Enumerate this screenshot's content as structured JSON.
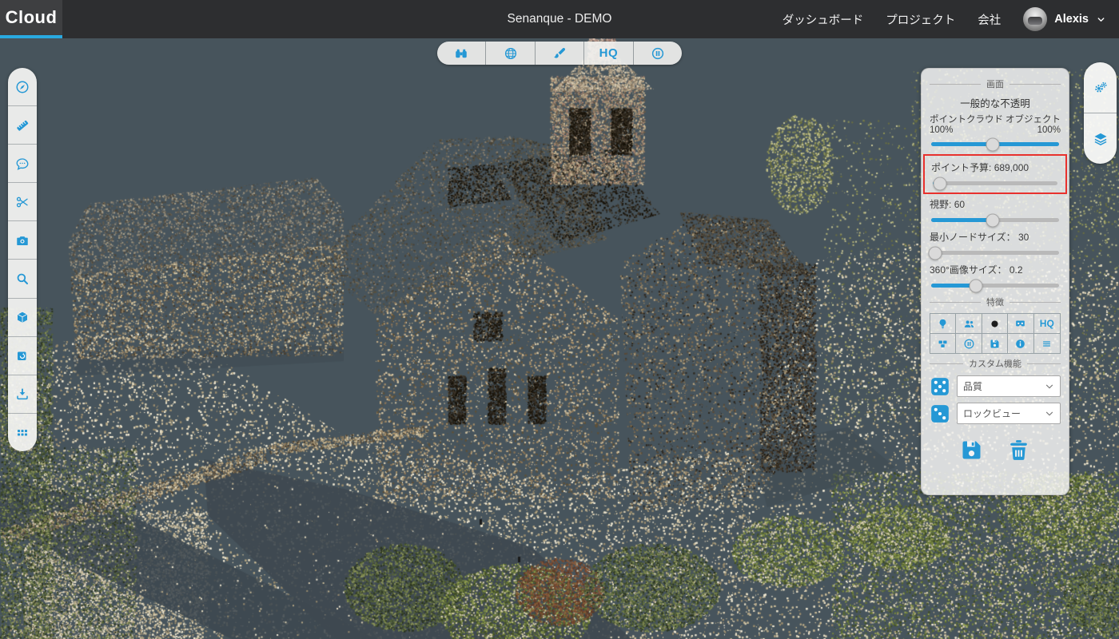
{
  "navbar": {
    "brand": "Cloud",
    "title": "Senanque - DEMO",
    "menu": [
      {
        "label": "ダッシュボード"
      },
      {
        "label": "プロジェクト"
      },
      {
        "label": "会社"
      }
    ],
    "user": {
      "name": "Alexis"
    }
  },
  "viewer_toolbar": {
    "hq_label": "HQ",
    "icons": [
      "binoculars",
      "globe",
      "brush",
      "hq",
      "pause-circle"
    ]
  },
  "left_toolbar": {
    "icons": [
      "compass",
      "ruler",
      "comment",
      "scissors",
      "camera",
      "search",
      "cube",
      "rotate-view",
      "download",
      "apps-grid"
    ]
  },
  "side_buttons": {
    "icons": [
      "gears",
      "layers"
    ]
  },
  "right_panel": {
    "screen": {
      "title": "画面",
      "opacity_heading": "一般的な不透明",
      "pointcloud_label": "ポイントクラウド",
      "object_label": "オブジェクト",
      "pointcloud_value": "100%",
      "object_value": "100%",
      "point_budget_label": "ポイント予算:",
      "point_budget_value": "689,000",
      "fov_label": "視野:",
      "fov_value": "60",
      "min_node_label": "最小ノードサイズ：",
      "min_node_value": "30",
      "image360_label": "360°画像サイズ：",
      "image360_value": "0.2"
    },
    "sliders": {
      "opacity": {
        "fill": 100,
        "pos": 48
      },
      "budget": {
        "fill": 6,
        "pos": 6
      },
      "fov": {
        "fill": 48,
        "pos": 48
      },
      "min_node": {
        "fill": 0,
        "pos": 3
      },
      "image360": {
        "fill": 35,
        "pos": 35
      }
    },
    "features": {
      "title": "特徴",
      "hq_label": "HQ",
      "icons": [
        "lightbulb",
        "users",
        "black-point",
        "vr-goggles",
        "hq",
        "blocks",
        "pause-circle",
        "save",
        "info",
        "menu-bars"
      ]
    },
    "custom": {
      "title": "カスタム機能",
      "quality_value": "品質",
      "view_value": "ロックビュー",
      "icons": [
        "dice",
        "dice",
        "save",
        "trash"
      ]
    }
  },
  "colors": {
    "accent": "#2598d5",
    "navbar_bg": "#2d2e30",
    "brand_underline": "#29a9e0",
    "highlight_border": "#e8312d",
    "viewport_bg": "#47545c"
  }
}
